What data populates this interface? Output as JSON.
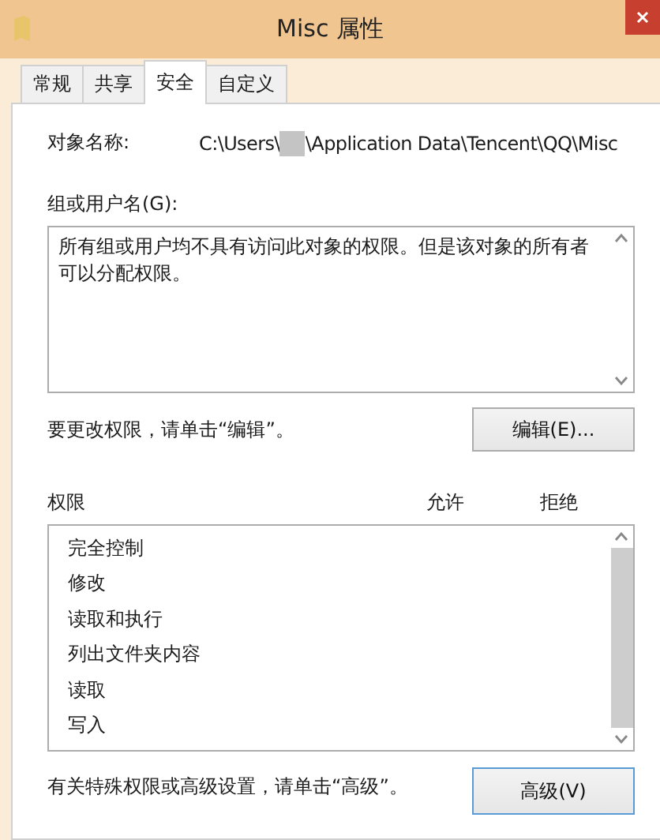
{
  "window": {
    "title": "Misc 属性"
  },
  "tabs": [
    {
      "label": "常规",
      "selected": false
    },
    {
      "label": "共享",
      "selected": false
    },
    {
      "label": "安全",
      "selected": true
    },
    {
      "label": "自定义",
      "selected": false
    }
  ],
  "object_name": {
    "label": "对象名称:",
    "path_start": "C:\\Users\\",
    "path_end": "\\Application Data\\Tencent\\QQ\\Misc"
  },
  "groups": {
    "label": "组或用户名(G):",
    "message": "所有组或用户均不具有访问此对象的权限。但是该对象的所有者可以分配权限。"
  },
  "edit_hint": "要更改权限，请单击“编辑”。",
  "edit_button": "编辑(E)...",
  "permissions": {
    "columns": [
      "权限",
      "允许",
      "拒绝"
    ],
    "rows": [
      "完全控制",
      "修改",
      "读取和执行",
      "列出文件夹内容",
      "读取",
      "写入"
    ]
  },
  "advanced_hint": "有关特殊权限或高级设置，请单击“高级”。",
  "advanced_button": "高级(V)"
}
